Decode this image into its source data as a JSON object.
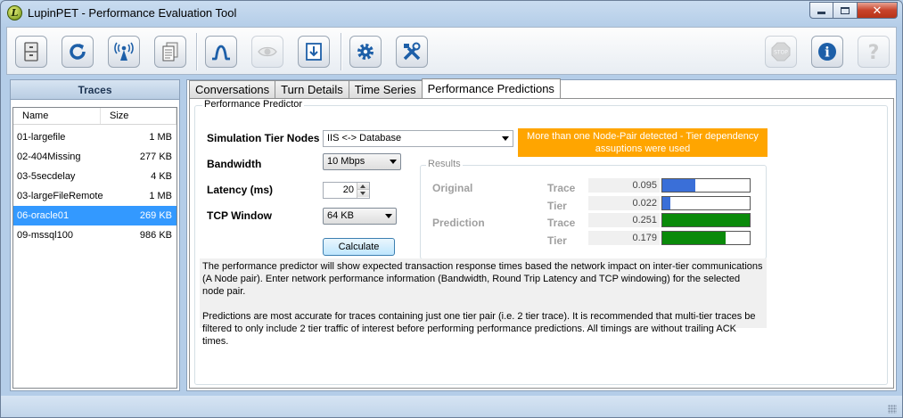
{
  "window": {
    "title": "LupinPET - Performance Evaluation Tool",
    "app_icon_letter": "L"
  },
  "toolbar": {
    "buttons": [
      {
        "name": "open-file",
        "icon": "file-cabinet-icon"
      },
      {
        "name": "refresh",
        "icon": "refresh-icon"
      },
      {
        "name": "capture",
        "icon": "antenna-icon"
      },
      {
        "name": "documents",
        "icon": "documents-icon"
      },
      {
        "name": "response",
        "icon": "curve-icon"
      },
      {
        "name": "view",
        "icon": "eye-icon"
      },
      {
        "name": "export",
        "icon": "export-icon"
      },
      {
        "name": "settings",
        "icon": "gear-icon"
      },
      {
        "name": "tools",
        "icon": "tools-icon"
      },
      {
        "name": "stop",
        "icon": "stop-icon",
        "label": "STOP"
      },
      {
        "name": "info",
        "icon": "info-icon",
        "label": "i"
      },
      {
        "name": "help",
        "icon": "help-icon",
        "label": "?"
      }
    ]
  },
  "traces": {
    "header": "Traces",
    "columns": {
      "name": "Name",
      "size": "Size"
    },
    "rows": [
      {
        "name": "01-largefile",
        "size": "1 MB"
      },
      {
        "name": "02-404Missing",
        "size": "277 KB"
      },
      {
        "name": "03-5secdelay",
        "size": "4 KB"
      },
      {
        "name": "03-largeFileRemote",
        "size": "1 MB"
      },
      {
        "name": "06-oracle01",
        "size": "269 KB",
        "selected": true
      },
      {
        "name": "09-mssql100",
        "size": "986 KB"
      }
    ]
  },
  "tabs": [
    "Conversations",
    "Turn Details",
    "Time Series",
    "Performance Predictions"
  ],
  "active_tab": "Performance Predictions",
  "predictor": {
    "group_title": "Performance Predictor",
    "labels": {
      "tier_nodes": "Simulation Tier Nodes",
      "bandwidth": "Bandwidth",
      "latency": "Latency (ms)",
      "tcp_window": "TCP Window"
    },
    "tier_nodes_value": "IIS <-> Database",
    "bandwidth_value": "10 Mbps",
    "latency_value": "20",
    "tcp_window_value": "64 KB",
    "calculate_label": "Calculate",
    "warning_line1": "More than one Node-Pair detected - Tier dependency",
    "warning_line2": "assuptions were used",
    "warning_color": "#ffa500"
  },
  "results": {
    "title": "Results",
    "original_label": "Original",
    "prediction_label": "Prediction",
    "rows": [
      {
        "kind": "Trace",
        "value": "0.095",
        "fill": 0.38,
        "color": "#3a6fd8"
      },
      {
        "kind": "Tier",
        "value": "0.022",
        "fill": 0.09,
        "color": "#3a6fd8"
      },
      {
        "kind": "Trace",
        "value": "0.251",
        "fill": 1.0,
        "color": "#0a8a0a"
      },
      {
        "kind": "Tier",
        "value": "0.179",
        "fill": 0.72,
        "color": "#0a8a0a"
      }
    ]
  },
  "info": {
    "para1": "The performance predictor will show expected transaction response times based the network impact on inter-tier communications (A Node pair). Enter network performance information (Bandwidth, Round Trip Latency and TCP windowing) for the selected node pair.",
    "para2": "Predictions are most accurate for traces containing just one tier pair (i.e. 2 tier trace). It is recommended that multi-tier traces be filtered to only include 2 tier traffic of interest before performing performance predictions. All timings are without trailing ACK times."
  }
}
